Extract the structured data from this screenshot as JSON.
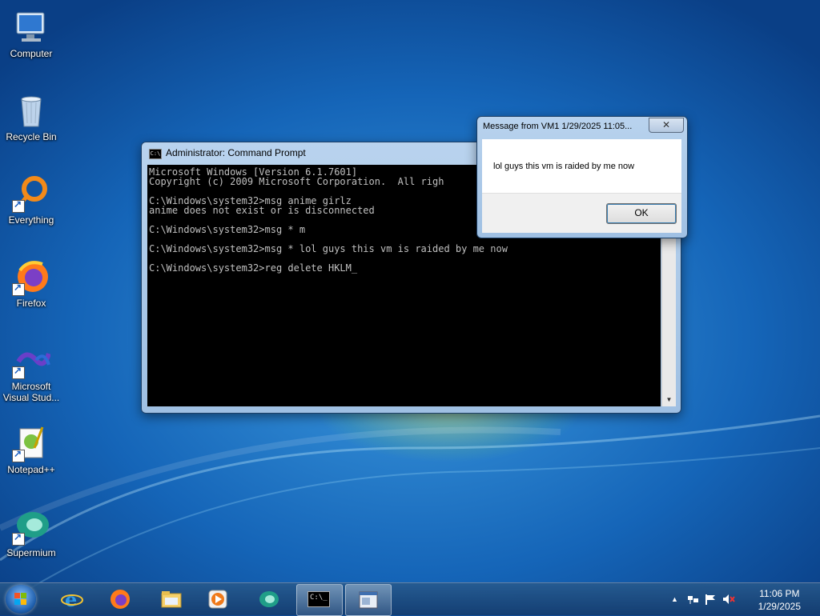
{
  "desktop_icons": [
    {
      "label": "Computer"
    },
    {
      "label": "Recycle Bin"
    },
    {
      "label": "Everything"
    },
    {
      "label": "Firefox"
    },
    {
      "label": "Microsoft\nVisual Stud..."
    },
    {
      "label": "Notepad++"
    },
    {
      "label": "Supermium"
    }
  ],
  "cmd_window": {
    "title": "Administrator: Command Prompt",
    "icon_text": "C:\\",
    "lines": [
      "Microsoft Windows [Version 6.1.7601]",
      "Copyright (c) 2009 Microsoft Corporation.  All righ",
      "",
      "C:\\Windows\\system32>msg anime girlz",
      "anime does not exist or is disconnected",
      "",
      "C:\\Windows\\system32>msg * m",
      "",
      "C:\\Windows\\system32>msg * lol guys this vm is raided by me now",
      "",
      "C:\\Windows\\system32>reg delete HKLM_"
    ]
  },
  "message_box": {
    "title": "Message from VM1 1/29/2025 11:05...",
    "close_label": "✕",
    "text": "lol guys this vm is raided by me now",
    "ok_label": "OK"
  },
  "taskbar": {
    "clock_time": "11:06 PM",
    "clock_date": "1/29/2025",
    "tray_arrow": "▲",
    "cmd_button_text": "C:\\_"
  },
  "colors": {
    "console_bg": "#000000",
    "console_text": "#c0c0c0",
    "desktop_blue": "#1565b8"
  }
}
